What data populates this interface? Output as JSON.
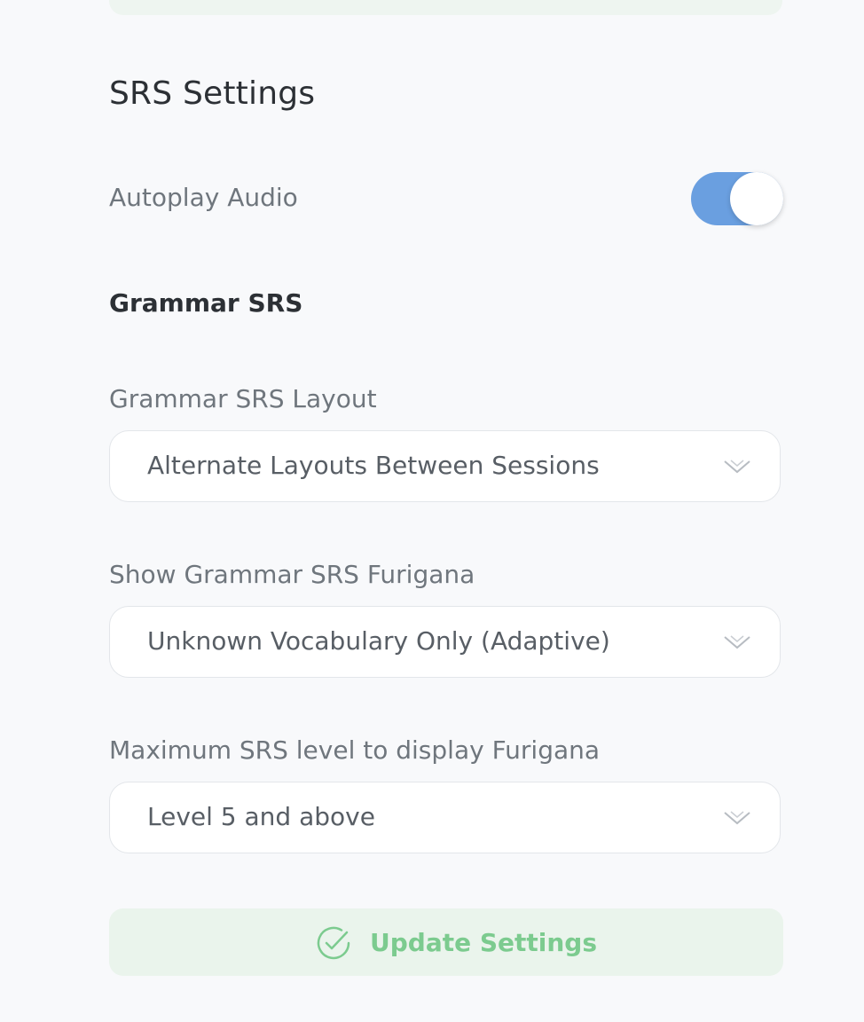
{
  "srs_settings": {
    "title": "SRS Settings",
    "autoplay_audio": {
      "label": "Autoplay Audio",
      "enabled": true
    },
    "grammar_srs": {
      "heading": "Grammar SRS",
      "layout": {
        "label": "Grammar SRS Layout",
        "value": "Alternate Layouts Between Sessions"
      },
      "furigana": {
        "label": "Show Grammar SRS Furigana",
        "value": "Unknown Vocabulary Only (Adaptive)"
      },
      "max_level": {
        "label": "Maximum SRS level to display Furigana",
        "value": "Level 5 and above"
      }
    },
    "update_button": {
      "label": "Update Settings"
    }
  },
  "icons": {
    "dropdown": "chevron-down-icon",
    "update": "check-circle-icon"
  },
  "colors": {
    "toggle_on": "#6a9fe0",
    "update_text": "#7ccb8f",
    "update_bg": "#eaf4ec"
  }
}
